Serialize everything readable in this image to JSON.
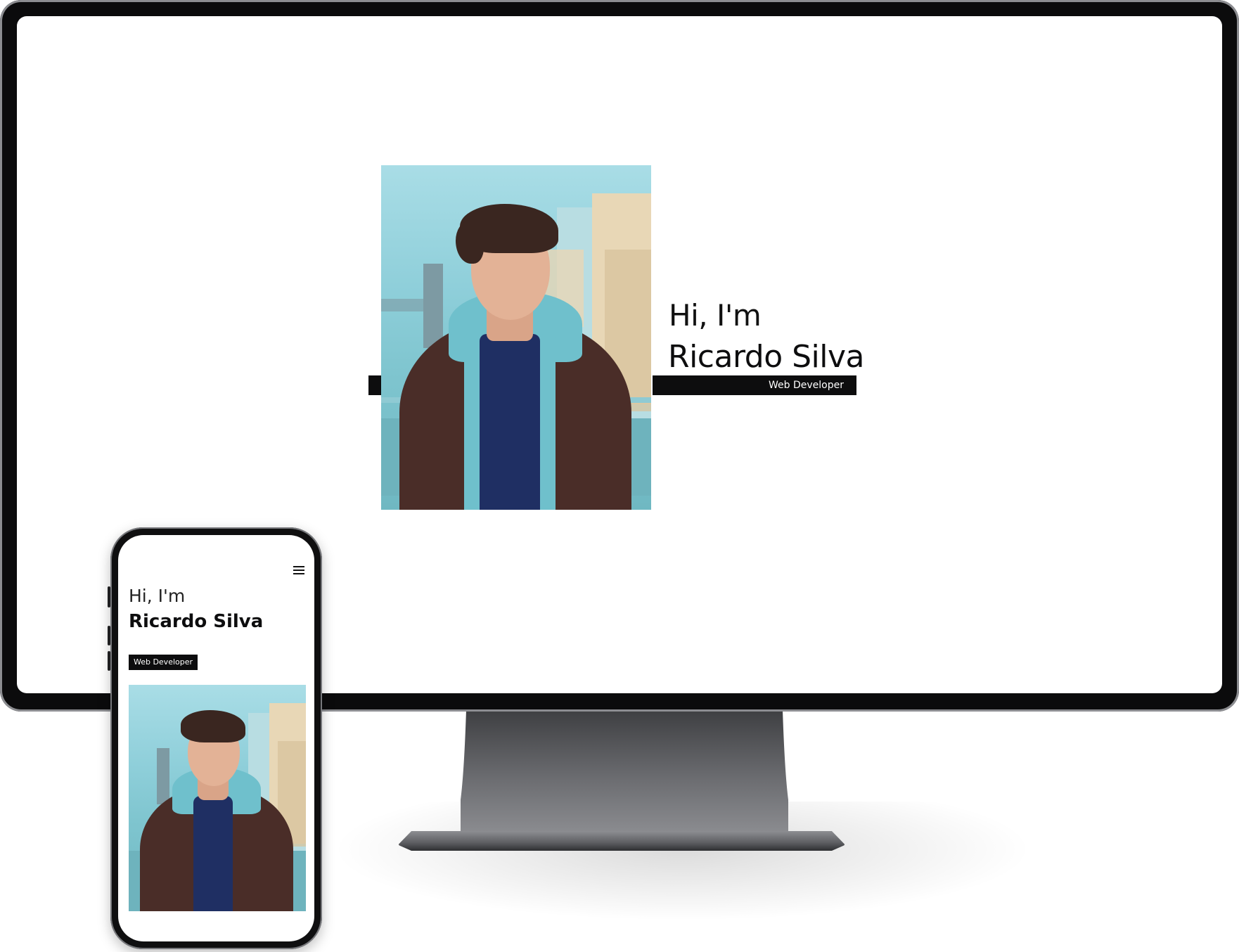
{
  "desktop": {
    "greeting": "Hi, I'm",
    "name": "Ricardo Silva",
    "role": "Web Developer"
  },
  "mobile": {
    "greeting": "Hi, I'm",
    "name": "Ricardo Silva",
    "role": "Web Developer",
    "menu_icon": "hamburger-menu-icon"
  },
  "colors": {
    "accent_bar": "#0d0d0e",
    "background": "#ffffff"
  }
}
